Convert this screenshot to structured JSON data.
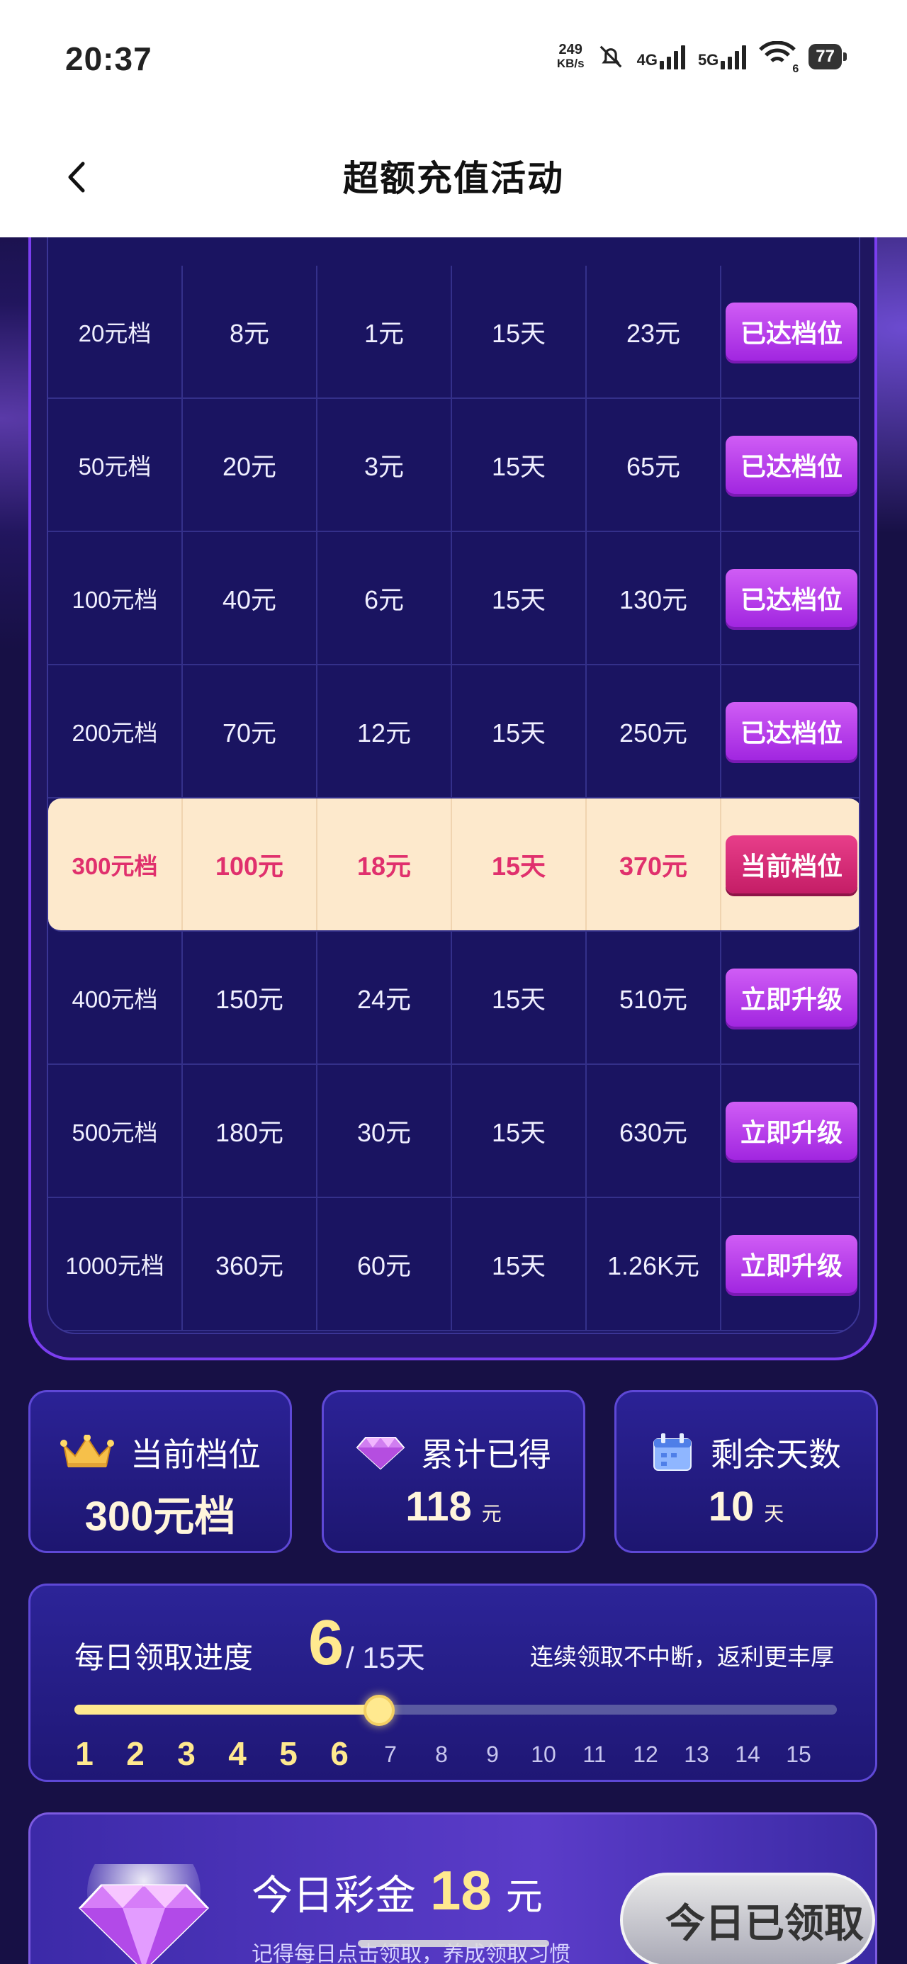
{
  "status_bar": {
    "time": "20:37",
    "net_speed_value": "249",
    "net_speed_unit": "KB/s",
    "sig1": "4G",
    "sig2": "5G",
    "wifi_sub": "6",
    "battery": "77"
  },
  "header": {
    "title": "超额充值活动"
  },
  "table": {
    "rows": [
      {
        "tier": "20元档",
        "c2": "8元",
        "c3": "1元",
        "c4": "15天",
        "c5": "23元",
        "action": "已达档位",
        "state": "reached"
      },
      {
        "tier": "50元档",
        "c2": "20元",
        "c3": "3元",
        "c4": "15天",
        "c5": "65元",
        "action": "已达档位",
        "state": "reached"
      },
      {
        "tier": "100元档",
        "c2": "40元",
        "c3": "6元",
        "c4": "15天",
        "c5": "130元",
        "action": "已达档位",
        "state": "reached"
      },
      {
        "tier": "200元档",
        "c2": "70元",
        "c3": "12元",
        "c4": "15天",
        "c5": "250元",
        "action": "已达档位",
        "state": "reached"
      },
      {
        "tier": "300元档",
        "c2": "100元",
        "c3": "18元",
        "c4": "15天",
        "c5": "370元",
        "action": "当前档位",
        "state": "current"
      },
      {
        "tier": "400元档",
        "c2": "150元",
        "c3": "24元",
        "c4": "15天",
        "c5": "510元",
        "action": "立即升级",
        "state": "upgrade"
      },
      {
        "tier": "500元档",
        "c2": "180元",
        "c3": "30元",
        "c4": "15天",
        "c5": "630元",
        "action": "立即升级",
        "state": "upgrade"
      },
      {
        "tier": "1000元档",
        "c2": "360元",
        "c3": "60元",
        "c4": "15天",
        "c5": "1.26K元",
        "action": "立即升级",
        "state": "upgrade"
      }
    ]
  },
  "stats": {
    "current_tier": {
      "label": "当前档位",
      "value": "300元档",
      "icon": "crown-icon"
    },
    "earned": {
      "label": "累计已得",
      "value": "118",
      "unit": "元",
      "icon": "gem-icon"
    },
    "days_left": {
      "label": "剩余天数",
      "value": "10",
      "unit": "天",
      "icon": "calendar-icon"
    }
  },
  "progress": {
    "title": "每日领取进度",
    "current": "6",
    "total": "/ 15天",
    "tip": "连续领取不中断，返利更丰厚",
    "fraction": 0.4,
    "days": [
      "1",
      "2",
      "3",
      "4",
      "5",
      "6",
      "7",
      "8",
      "9",
      "10",
      "11",
      "12",
      "13",
      "14",
      "15"
    ],
    "completed_days": 6
  },
  "bonus": {
    "label": "今日彩金",
    "value": "18",
    "unit": "元",
    "tip": "记得每日点击领取，养成领取习惯",
    "claim_label": "今日已领取"
  },
  "colors": {
    "accent_purple": "#a126e0",
    "current_pink": "#e0306d",
    "gold": "#ffe98f",
    "background": "#171045"
  }
}
